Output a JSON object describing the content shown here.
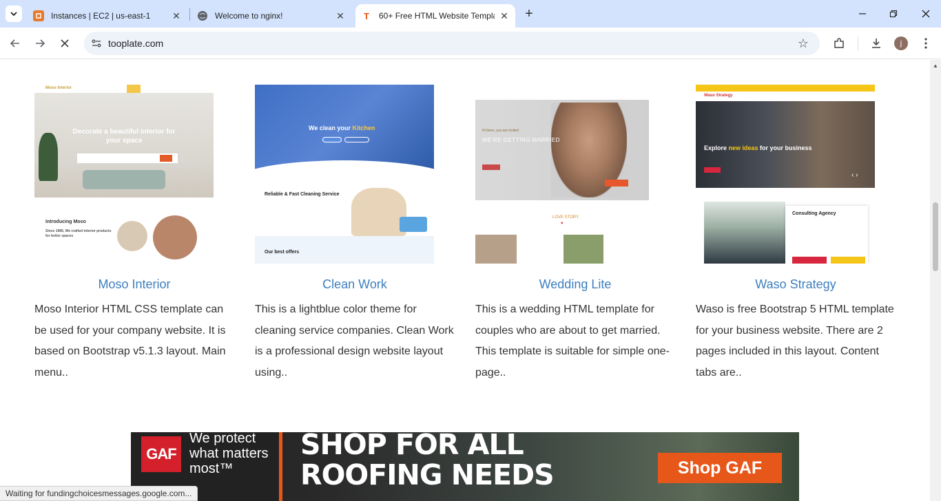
{
  "tabs": [
    {
      "title": "Instances | EC2 | us-east-1",
      "favicon": "aws-ec2-icon",
      "favicon_color": "#e77a2b"
    },
    {
      "title": "Welcome to nginx!",
      "favicon": "globe-icon",
      "favicon_color": "#5f6368"
    },
    {
      "title": "60+ Free HTML Website Templa",
      "favicon": "tooplate-icon",
      "favicon_color": "#e8571a",
      "favicon_text": "T"
    }
  ],
  "toolbar": {
    "url": "tooplate.com",
    "avatar_letter": "j"
  },
  "cards": [
    {
      "title": "Moso Interior",
      "description": "Moso Interior HTML CSS template can be used for your company website. It is based on Bootstrap v5.1.3 layout. Main menu..",
      "thumb": {
        "logo": "Moso Interior",
        "headline": "Decorate a beautiful interior for your space",
        "intro": "Introducing Moso",
        "since": "Since 1986, We crafted interior products for better spaces"
      }
    },
    {
      "title": "Clean Work",
      "description": "This is a lightblue color theme for cleaning service companies. Clean Work is a professional design website layout using..",
      "thumb": {
        "headline_a": "We clean your ",
        "headline_b": "Kitchen",
        "reliable": "Reliable & Fast Cleaning Service",
        "offers": "Our best offers"
      }
    },
    {
      "title": "Wedding Lite",
      "description": "This is a wedding HTML template for couples who are about to get married. This template is suitable for simple one-page..",
      "thumb": {
        "invited": "Hi there, you are invited",
        "headline": "WE'RE GETTING MARRIED",
        "love": "LOVE STORY",
        "heart": "♥"
      }
    },
    {
      "title": "Waso Strategy",
      "description": "Waso is free Bootstrap 5 HTML template for your business website. There are 2 pages included in this layout. Content tabs are..",
      "thumb": {
        "logo": "Waso Strategy",
        "headline_a": "Explore ",
        "headline_b": "new ideas",
        "headline_c": " for your business",
        "agency": "Consulting Agency",
        "arrows": "‹ ›"
      }
    }
  ],
  "ad": {
    "logo": "GAF",
    "tagline_1": "We protect",
    "tagline_2": "what matters",
    "tagline_3": "most™",
    "headline_1": "SHOP FOR ALL",
    "headline_2": "ROOFING NEEDS",
    "cta": "Shop GAF",
    "brand_color": "#d3202a",
    "accent_color": "#e8571a"
  },
  "status": "Waiting for fundingchoicesmessages.google.com..."
}
